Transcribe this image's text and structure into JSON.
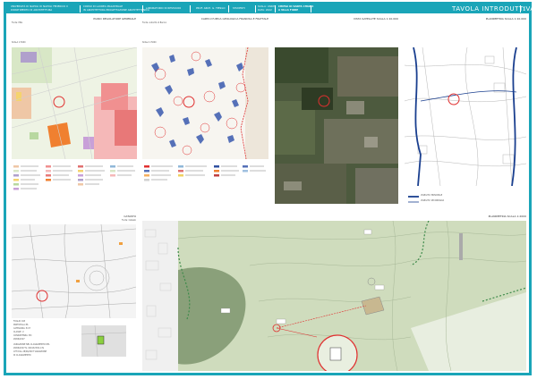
{
  "header": {
    "university_line1": "UNIVERSITÀ DI NAPOLI DI NAPOLI FEDERICO II",
    "university_line2": "DIPARTIMENTO DI ARCHITETTURA",
    "course_line1": "CORSO DI LAUREA MAGISTRALE",
    "course_line2": "IN ARCHITETTURA PROGETTAZIONE ARCHITETTONICA",
    "lab": "LABORATORIO DI RESTAURO",
    "prof": "PROF. ARCH. G. FIENGO",
    "student": "STUDENTI",
    "scale1": "SCALA: VARIE",
    "scale2": "DATA: 2022",
    "project_line1": "CHIESA DI SANTA CHIARA",
    "project_line2": "A VILLA FIORE",
    "title": "TAVOLA INTRODUTTIVA",
    "sheet_no": "1"
  },
  "panels": {
    "prg": {
      "title": "PIANO REGOLATORE GENERALE",
      "ref": "Fonte: PRG",
      "note": "SCALA 1:5000"
    },
    "carta": {
      "title": "CARTA D'UPICA GEOLOGICA FRANOSA E FRATTALE",
      "ref": "Fonte: Autorità di Bacino",
      "note": "SCALA 1:5000"
    },
    "satellite": {
      "title": "VISTA SATELLITE SCALA 1:10.000"
    },
    "planimetria_top": {
      "title": "PLANIMETRIA SCALA 1:10.000",
      "legend_main": "VIABILITA' PRINCIPALE",
      "legend_sec": "VIABILITA' SECONDARIA"
    },
    "catasto": {
      "title": "CATASTO",
      "ref": "Fonte: Catasto",
      "foglio": "FOGLIO 043",
      "particella": "PARTICELLA 86",
      "categoria": "CATEGORIA: B 07",
      "classe": "CLASSE: U",
      "consistenza": "CONSISTENZA: MC",
      "date": "28/06/2007",
      "note1": "VARIAZIONE NEL CLASSAMENTO DEL",
      "note2": "28/06/2007 N. 000132309.1 IN",
      "note3": "ATTI DAL 28/06/2007 VARIAZIONE",
      "note4": "DI CLASSAMENTO"
    },
    "planimetria_bottom": {
      "title": "PLANIMETRIA SCALA 1:2000"
    }
  },
  "colors": {
    "accent": "#1aa5b8",
    "marker": "#e03030",
    "green_area": "#cfdcbd",
    "dark_green": "#3e5e3a"
  }
}
